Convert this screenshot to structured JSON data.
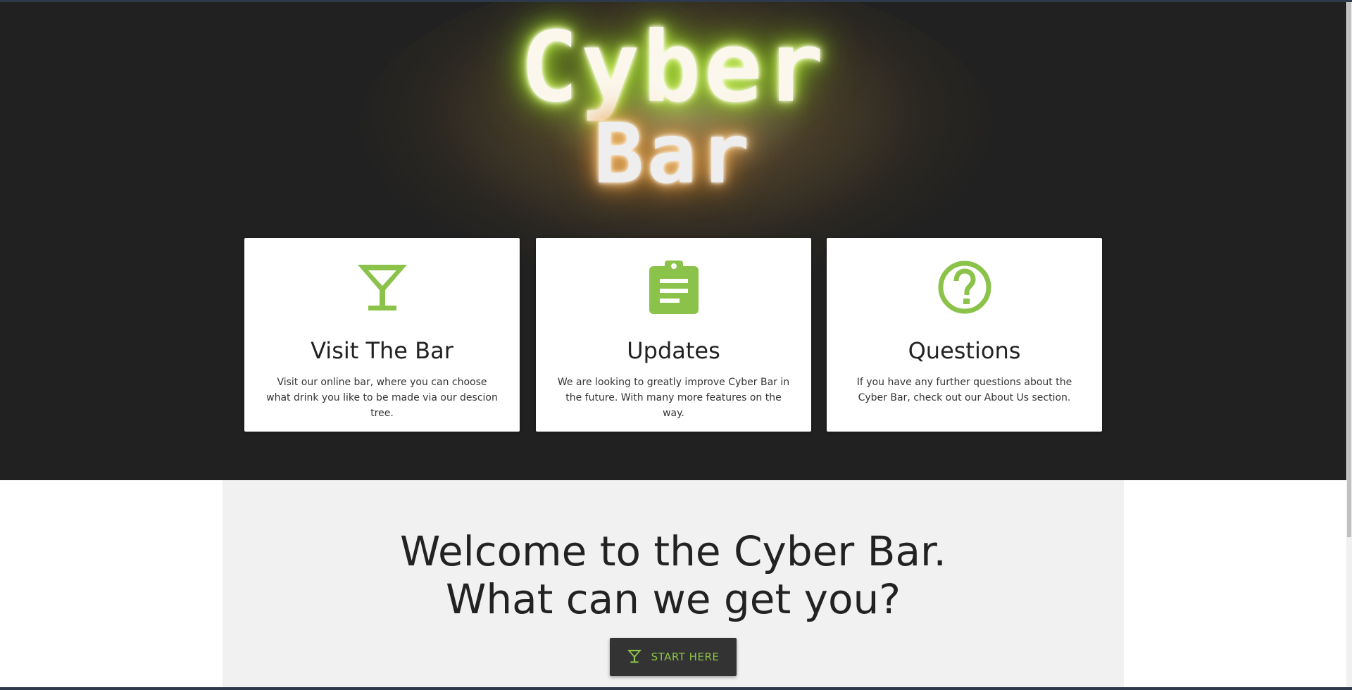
{
  "logo": {
    "line1": "Cyber",
    "line2": "Bar"
  },
  "cards": [
    {
      "icon": "cocktail-glass-icon",
      "title": "Visit The Bar",
      "text": "Visit our online bar, where you can choose what drink you like to be made via our descion tree."
    },
    {
      "icon": "clipboard-list-icon",
      "title": "Updates",
      "text": "We are looking to greatly improve Cyber Bar in the future. With many more features on the way."
    },
    {
      "icon": "question-circle-icon",
      "title": "Questions",
      "text": "If you have any further questions about the Cyber Bar, check out our About Us section."
    }
  ],
  "welcome": {
    "line1": "Welcome to the Cyber Bar.",
    "line2": "What can we get you?",
    "button_label": "START HERE",
    "button_icon": "cocktail-glass-icon"
  },
  "colors": {
    "accent": "#8bc34a",
    "hero_background": "#212121",
    "welcome_background": "#f1f1f1",
    "button_background": "#333333"
  }
}
